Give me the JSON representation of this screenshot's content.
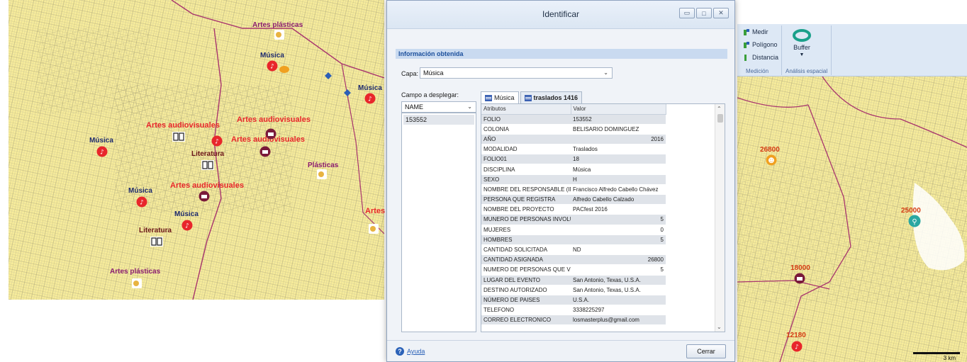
{
  "left_map": {
    "labels": {
      "artes_plasticas_top": "Artes plásticas",
      "musica_1": "Música",
      "musica_2": "Música",
      "artes_audiovisuales_1": "Artes audiovisuales",
      "artes_audiovisuales_2": "Artes audiovisuales",
      "artes_audiovisuales_3": "Artes audiovisuales",
      "artes_audiovisuales_4": "Artes audiovisuales",
      "musica_3": "Música",
      "literatura_1": "Literatura",
      "plasticas": "Plásticas",
      "musica_4": "Música",
      "musica_5": "Música",
      "literatura_2": "Literatura",
      "artes_plasticas_bottom": "Artes plásticas",
      "artes_edge": "Artes"
    },
    "colors": {
      "map_fill": "#f7ec9b",
      "streets": "#b3ad80",
      "boundary": "#a8356e",
      "music_marker": "#e8262b",
      "audiovisual_marker": "#7a1a3a"
    }
  },
  "dialog": {
    "title": "Identificar",
    "window_buttons": [
      "minimize-icon",
      "maximize-icon",
      "close-icon"
    ],
    "section_header": "Información obtenida",
    "layer_label": "Capa:",
    "layer_value": "Música",
    "field_label": "Campo a desplegar:",
    "field_value": "NAME",
    "list_items": [
      "153552"
    ],
    "tabs": [
      {
        "label": "Música"
      },
      {
        "label": "traslados 1416"
      }
    ],
    "columns": [
      "Atributos",
      "Valor"
    ],
    "rows": [
      {
        "k": "FOLIO",
        "v": "153552"
      },
      {
        "k": "COLONIA",
        "v": "BELISARIO DOMINGUEZ"
      },
      {
        "k": "AÑO",
        "v": "2016"
      },
      {
        "k": "MODALIDAD",
        "v": "Traslados"
      },
      {
        "k": "FOLIO01",
        "v": "18"
      },
      {
        "k": "DISCIPLINA",
        "v": "Música"
      },
      {
        "k": "SEXO",
        "v": "H"
      },
      {
        "k": "NOMBRE DEL RESPONSABLE (IN",
        "v": "Francisco Alfredo Cabello Chávez"
      },
      {
        "k": "PERSONA QUE REGISTRA",
        "v": "Alfredo Cabello Calzado"
      },
      {
        "k": "NOMBRE DEL PROYECTO",
        "v": "PACfest 2016"
      },
      {
        "k": "MUNERO DE PERSONAS INVOLU",
        "v": "5"
      },
      {
        "k": "MUJERES",
        "v": "0"
      },
      {
        "k": "HOMBRES",
        "v": "5"
      },
      {
        "k": "CANTIDAD SOLICITADA",
        "v": "ND"
      },
      {
        "k": "CANTIDAD ASIGNADA",
        "v": "26800"
      },
      {
        "k": "NUMERO DE PERSONAS QUE VI",
        "v": "5"
      },
      {
        "k": "LUGAR DEL EVENTO",
        "v": "San Antonio, Texas, U.S.A."
      },
      {
        "k": "DESTINO AUTORIZADO",
        "v": "San Antonio, Texas, U.S.A."
      },
      {
        "k": "NÚMERO DE PAISES",
        "v": "U.S.A."
      },
      {
        "k": "TELEFONO",
        "v": "3338225297"
      },
      {
        "k": "CORREO ELECTRONICO",
        "v": "losmasterplus@gmail.com"
      }
    ],
    "help_label": "Ayuda",
    "close_label": "Cerrar"
  },
  "ribbon": {
    "medir": "Medir",
    "poligono": "Polígono",
    "distancia": "Distancia",
    "buffer": "Buffer",
    "group_medicion": "Medición",
    "group_analisis": "Análisis espacial"
  },
  "right_map": {
    "labels": {
      "v1": "26800",
      "v2": "25000",
      "v3": "18000",
      "v4": "12180"
    },
    "scale_label": "3 km"
  }
}
